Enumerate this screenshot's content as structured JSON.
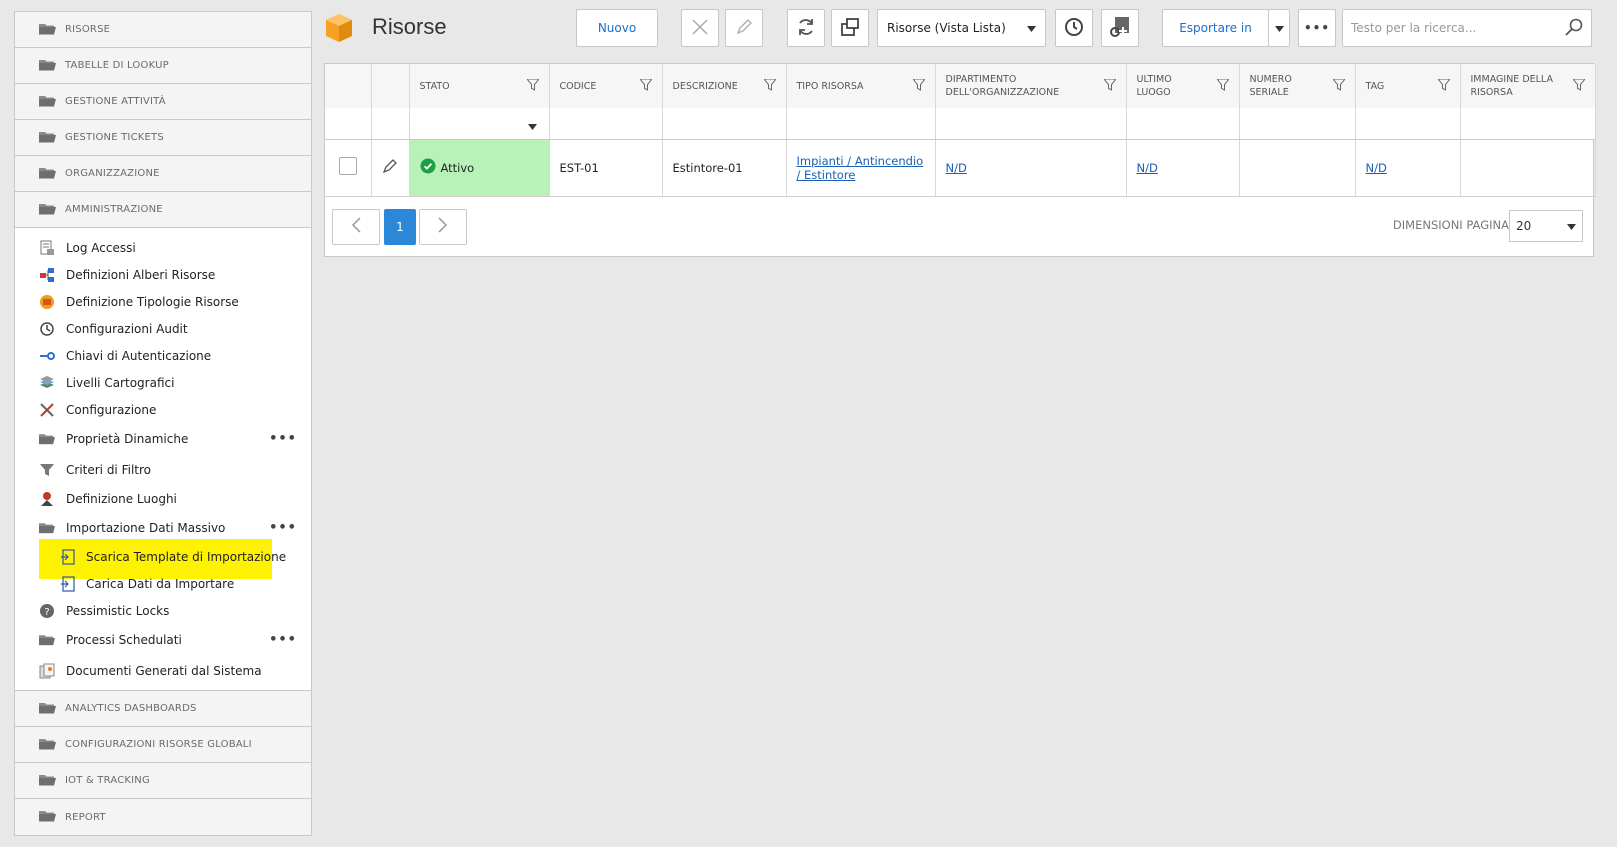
{
  "sidebar": {
    "top_sections": [
      "RISORSE",
      "TABELLE DI LOOKUP",
      "GESTIONE ATTIVITÀ",
      "GESTIONE TICKETS",
      "ORGANIZZAZIONE",
      "AMMINISTRAZIONE"
    ],
    "admin_items": [
      {
        "label": "Log Accessi",
        "icon": "log-icon"
      },
      {
        "label": "Definizioni Alberi Risorse",
        "icon": "tree-icon"
      },
      {
        "label": "Definizione Tipologie Risorse",
        "icon": "resource-type-icon"
      },
      {
        "label": "Configurazioni Audit",
        "icon": "history-icon"
      },
      {
        "label": "Chiavi di Autenticazione",
        "icon": "key-icon"
      },
      {
        "label": "Livelli Cartografici",
        "icon": "layers-icon"
      },
      {
        "label": "Configurazione",
        "icon": "tools-icon"
      },
      {
        "label": "Proprietà Dinamiche",
        "icon": "folder-icon"
      },
      {
        "label": "Criteri di Filtro",
        "icon": "filter-icon"
      },
      {
        "label": "Definizione Luoghi",
        "icon": "location-icon"
      },
      {
        "label": "Importazione Dati Massivo",
        "icon": "folder-icon"
      },
      {
        "label": "Scarica Template di Importazione",
        "icon": "import-icon"
      },
      {
        "label": "Carica Dati da Importare",
        "icon": "import-icon"
      },
      {
        "label": "Pessimistic Locks",
        "icon": "help-icon"
      },
      {
        "label": "Processi Schedulati",
        "icon": "folder-icon"
      },
      {
        "label": "Documenti Generati dal Sistema",
        "icon": "documents-icon"
      }
    ],
    "bottom_sections": [
      "ANALYTICS DASHBOARDS",
      "CONFIGURAZIONI RISORSE GLOBALI",
      "IOT & TRACKING",
      "REPORT"
    ]
  },
  "header": {
    "title": "Risorse",
    "new_label": "Nuovo",
    "view_select": "Risorse (Vista Lista)",
    "export_label": "Esportare in",
    "search_placeholder": "Testo per la ricerca..."
  },
  "grid": {
    "columns": [
      "STATO",
      "CODICE",
      "DESCRIZIONE",
      "TIPO RISORSA",
      "DIPARTIMENTO DELL'ORGANIZZAZIONE",
      "ULTIMO LUOGO",
      "NUMERO SERIALE",
      "TAG",
      "IMMAGINE DELLA RISORSA"
    ],
    "rows": [
      {
        "stato": "Attivo",
        "codice": "EST-01",
        "descrizione": "Estintore-01",
        "tipo_risorsa": "Impianti / Antincendio / Estintore",
        "dipartimento": "N/D",
        "ultimo_luogo": "N/D",
        "numero_seriale": "",
        "tag": "N/D",
        "immagine": ""
      }
    ],
    "pager": {
      "current_page": "1",
      "page_size_label": "DIMENSIONI PAGINA",
      "page_size": "20"
    }
  },
  "colors": {
    "accent": "#2b88d9",
    "status_active_bg": "#b8f2b8",
    "highlight": "#fff200",
    "logo": "#f7a021"
  }
}
